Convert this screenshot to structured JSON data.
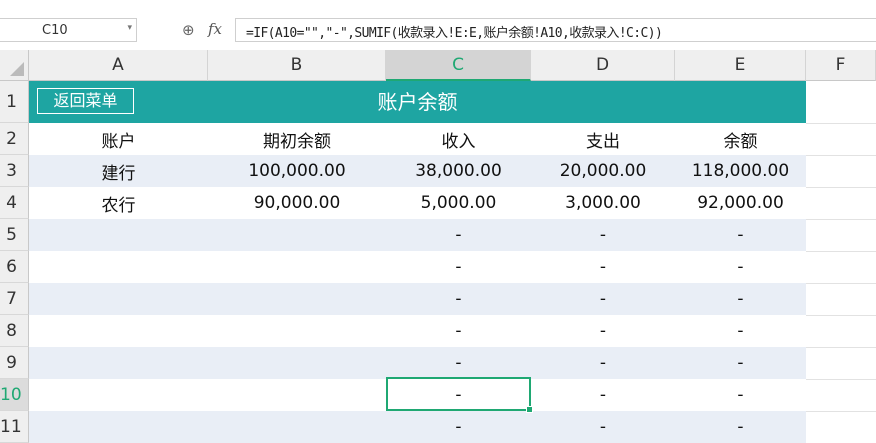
{
  "name_box": "C10",
  "formula": "=IF(A10=\"\",\"-\",SUMIF(收款录入!E:E,账户余额!A10,收款录入!C:C))",
  "icons": {
    "zoom": "zoom-search-icon",
    "fx": "function-icon",
    "dropdown": "chevron-down-icon"
  },
  "columns": [
    "A",
    "B",
    "C",
    "D",
    "E",
    "F"
  ],
  "selected_column": "C",
  "rows": [
    "1",
    "2",
    "3",
    "4",
    "5",
    "6",
    "7",
    "8",
    "9",
    "10",
    "11"
  ],
  "selected_row": "10",
  "sheet": {
    "title": "账户余额",
    "back_button": "返回菜单",
    "header": [
      "账户",
      "期初余额",
      "收入",
      "支出",
      "余额"
    ],
    "data": [
      [
        "建行",
        "100,000.00",
        "38,000.00",
        "20,000.00",
        "118,000.00"
      ],
      [
        "农行",
        "90,000.00",
        "5,000.00",
        "3,000.00",
        "92,000.00"
      ],
      [
        "",
        "",
        "-",
        "-",
        "-"
      ],
      [
        "",
        "",
        "-",
        "-",
        "-"
      ],
      [
        "",
        "",
        "-",
        "-",
        "-"
      ],
      [
        "",
        "",
        "-",
        "-",
        "-"
      ],
      [
        "",
        "",
        "-",
        "-",
        "-"
      ],
      [
        "",
        "",
        "-",
        "-",
        "-"
      ],
      [
        "",
        "",
        "-",
        "-",
        "-"
      ]
    ]
  },
  "colors": {
    "title_bg": "#1ea5a2",
    "stripe": "#e9eef6",
    "selection": "#1fa873"
  }
}
